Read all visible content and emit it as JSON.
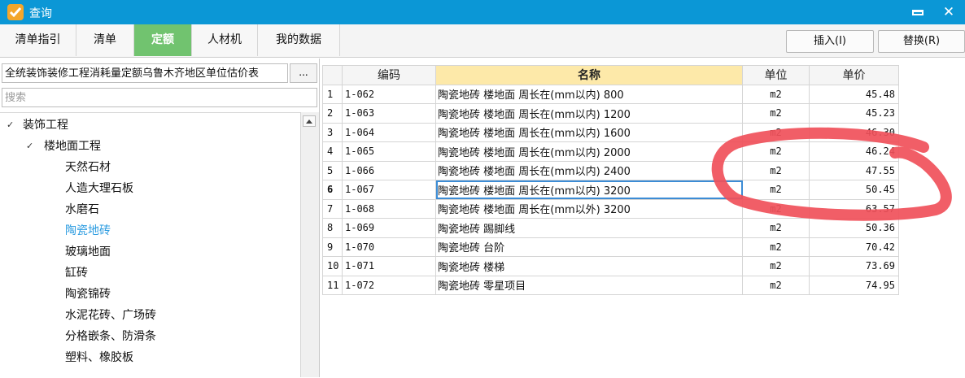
{
  "window": {
    "title": "查询",
    "minimize_glyph": "▬",
    "close_glyph": "✕"
  },
  "tabs": [
    {
      "label": "清单指引",
      "active": false
    },
    {
      "label": "清单",
      "active": false
    },
    {
      "label": "定额",
      "active": true
    },
    {
      "label": "人材机",
      "active": false
    },
    {
      "label": "我的数据",
      "active": false
    }
  ],
  "actions": {
    "insert_label": "插入(I)",
    "replace_label": "替换(R)"
  },
  "left_panel": {
    "quota_book": "全统装饰装修工程消耗量定额乌鲁木齐地区单位估价表",
    "ellipsis_label": "...",
    "search_placeholder": "搜索",
    "tree": [
      {
        "label": "装饰工程",
        "level": 0,
        "expanded": true
      },
      {
        "label": "楼地面工程",
        "level": 1,
        "expanded": true
      },
      {
        "label": "天然石材",
        "level": 2
      },
      {
        "label": "人造大理石板",
        "level": 2
      },
      {
        "label": "水磨石",
        "level": 2
      },
      {
        "label": "陶瓷地砖",
        "level": 2,
        "selected": true
      },
      {
        "label": "玻璃地面",
        "level": 2
      },
      {
        "label": "缸砖",
        "level": 2
      },
      {
        "label": "陶瓷锦砖",
        "level": 2
      },
      {
        "label": "水泥花砖、广场砖",
        "level": 2
      },
      {
        "label": "分格嵌条、防滑条",
        "level": 2
      },
      {
        "label": "塑料、橡胶板",
        "level": 2
      }
    ]
  },
  "table": {
    "columns": [
      "编码",
      "名称",
      "单位",
      "单价"
    ],
    "current_row": 6,
    "rows": [
      {
        "no": "1",
        "code": "1-062",
        "name": "陶瓷地砖 楼地面 周长在(mm以内) 800",
        "unit": "m2",
        "price": "45.48"
      },
      {
        "no": "2",
        "code": "1-063",
        "name": "陶瓷地砖 楼地面 周长在(mm以内) 1200",
        "unit": "m2",
        "price": "45.23"
      },
      {
        "no": "3",
        "code": "1-064",
        "name": "陶瓷地砖 楼地面 周长在(mm以内) 1600",
        "unit": "m2",
        "price": "46.30"
      },
      {
        "no": "4",
        "code": "1-065",
        "name": "陶瓷地砖 楼地面 周长在(mm以内) 2000",
        "unit": "m2",
        "price": "46.24"
      },
      {
        "no": "5",
        "code": "1-066",
        "name": "陶瓷地砖 楼地面 周长在(mm以内) 2400",
        "unit": "m2",
        "price": "47.55"
      },
      {
        "no": "6",
        "code": "1-067",
        "name": "陶瓷地砖 楼地面 周长在(mm以内) 3200",
        "unit": "m2",
        "price": "50.45"
      },
      {
        "no": "7",
        "code": "1-068",
        "name": "陶瓷地砖 楼地面 周长在(mm以外) 3200",
        "unit": "m2",
        "price": "63.57"
      },
      {
        "no": "8",
        "code": "1-069",
        "name": "陶瓷地砖 踢脚线",
        "unit": "m2",
        "price": "50.36"
      },
      {
        "no": "9",
        "code": "1-070",
        "name": "陶瓷地砖 台阶",
        "unit": "m2",
        "price": "70.42"
      },
      {
        "no": "10",
        "code": "1-071",
        "name": "陶瓷地砖 楼梯",
        "unit": "m2",
        "price": "73.69"
      },
      {
        "no": "11",
        "code": "1-072",
        "name": "陶瓷地砖 零星项目",
        "unit": "m2",
        "price": "74.95"
      }
    ]
  },
  "colors": {
    "titlebar": "#0b97d6",
    "active_tab": "#71c36f",
    "name_header": "#fde9a9",
    "selected_tree": "#2a9be0",
    "annotation": "#f0505a"
  }
}
